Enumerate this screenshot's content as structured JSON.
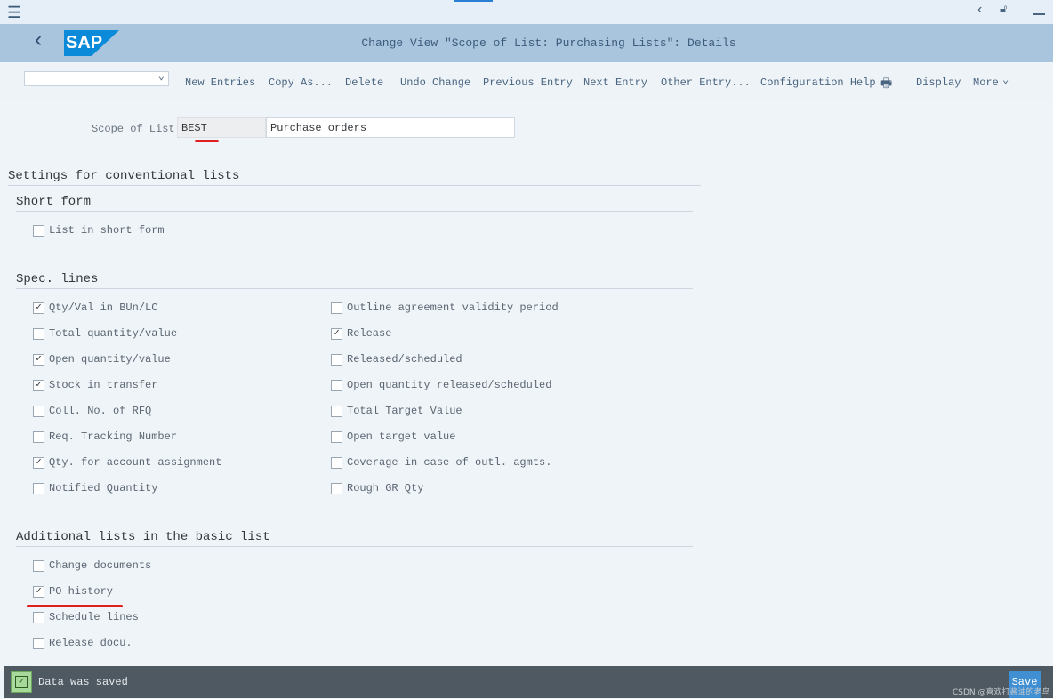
{
  "title": "Change View \"Scope of List: Purchasing Lists\": Details",
  "toolbar": {
    "items": [
      "New Entries",
      "Copy As...",
      "Delete",
      "Undo Change",
      "Previous Entry",
      "Next Entry",
      "Other Entry...",
      "Configuration Help",
      "Display",
      "More"
    ]
  },
  "scope": {
    "label": "Scope of List:",
    "code": "BEST",
    "description": "Purchase orders"
  },
  "sections": {
    "conventional": "Settings for conventional lists",
    "short_form": "Short form",
    "spec_lines": "Spec. lines",
    "additional": "Additional lists in the basic list"
  },
  "short_form": [
    {
      "label": "List in short form",
      "checked": false
    }
  ],
  "spec_left": [
    {
      "label": "Qty/Val in BUn/LC",
      "checked": true
    },
    {
      "label": "Total quantity/value",
      "checked": false
    },
    {
      "label": "Open quantity/value",
      "checked": true
    },
    {
      "label": "Stock in transfer",
      "checked": true
    },
    {
      "label": "Coll. No. of RFQ",
      "checked": false
    },
    {
      "label": "Req. Tracking Number",
      "checked": false
    },
    {
      "label": "Qty. for account assignment",
      "checked": true
    },
    {
      "label": "Notified Quantity",
      "checked": false
    }
  ],
  "spec_right": [
    {
      "label": "Outline agreement validity period",
      "checked": false
    },
    {
      "label": "Release",
      "checked": true
    },
    {
      "label": "Released/scheduled",
      "checked": false
    },
    {
      "label": "Open quantity released/scheduled",
      "checked": false
    },
    {
      "label": "Total Target Value",
      "checked": false
    },
    {
      "label": "Open target value",
      "checked": false
    },
    {
      "label": "Coverage in case of outl. agmts.",
      "checked": false
    },
    {
      "label": "Rough GR Qty",
      "checked": false
    }
  ],
  "additional": [
    {
      "label": "Change documents",
      "checked": false
    },
    {
      "label": "PO history",
      "checked": true
    },
    {
      "label": "Schedule lines",
      "checked": false
    },
    {
      "label": "Release docu.",
      "checked": false
    }
  ],
  "status": {
    "message": "Data was saved",
    "save": "Save"
  },
  "watermark": "CSDN @喜欢打酱油的老鸟",
  "colors": {
    "header": "#a9c5de",
    "status_bar": "#4f5962",
    "annotation": "#e02020",
    "logo": "#0a8ad8"
  }
}
